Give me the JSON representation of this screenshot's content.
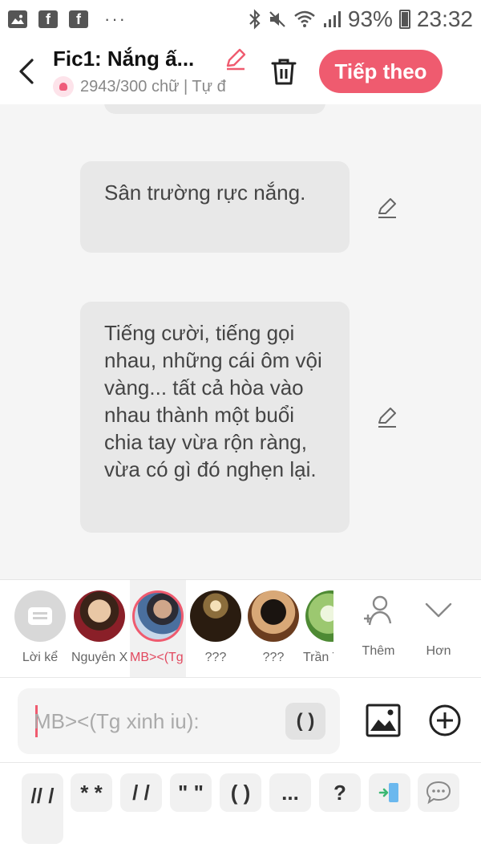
{
  "status_bar": {
    "battery": "93%",
    "time": "23:32"
  },
  "header": {
    "story_title": "Fic1: Nắng ấ...",
    "word_count": "2943/300 chữ | Tự đ",
    "next_label": "Tiếp theo"
  },
  "messages": [
    {
      "text": "Sân trường rực nắng."
    },
    {
      "text": "Tiếng cười, tiếng gọi nhau, những cái ôm vội vàng... tất cả hòa vào nhau thành một buổi chia tay vừa rộn ràng, vừa có gì đó nghẹn lại."
    }
  ],
  "characters": [
    {
      "label": "Lời kể",
      "icon": "narrator-icon"
    },
    {
      "label": "Nguyễn X..."
    },
    {
      "label": "MB><(Tg x..."
    },
    {
      "label": "???"
    },
    {
      "label": "???"
    },
    {
      "label": "Trần T"
    }
  ],
  "char_actions": {
    "add_label": "Thêm",
    "more_label": "Hơn"
  },
  "composer": {
    "placeholder": "MB><(Tg xinh iu):",
    "paren_label": "( )"
  },
  "shortcuts": [
    "// /",
    "* *",
    "/ /",
    "\" \"",
    "( )",
    "...",
    "?"
  ],
  "colors": {
    "accent": "#ef5b6f",
    "bubble": "#e8e8e8",
    "background": "#f5f5f5"
  }
}
